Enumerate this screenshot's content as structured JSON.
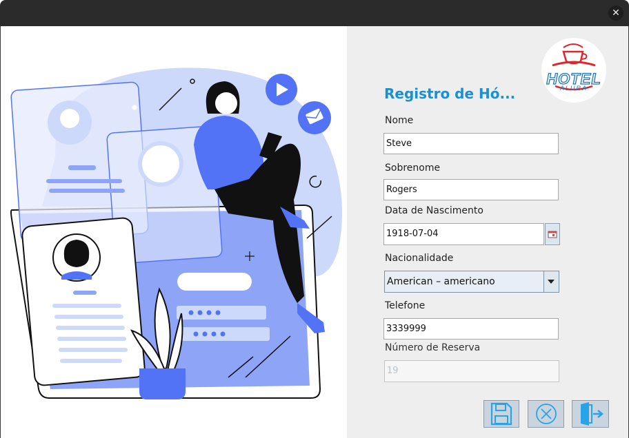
{
  "window": {
    "close_icon": "close-icon"
  },
  "brand": {
    "logo_line1": "HOTEL",
    "logo_line2": "ALURA",
    "logo_color": "#e0242a"
  },
  "form": {
    "title": "Registro de Hó...",
    "title_color": "#1b8fd0",
    "fields": {
      "nome": {
        "label": "Nome",
        "value": "Steve"
      },
      "sobrenome": {
        "label": "Sobrenome",
        "value": "Rogers"
      },
      "data_nascimento": {
        "label": "Data de Nascimento",
        "value": "1918-07-04"
      },
      "nacionalidade": {
        "label": "Nacionalidade",
        "value": "American – americano"
      },
      "telefone": {
        "label": "Telefone",
        "value": "3339999"
      },
      "numero_reserva": {
        "label": "Número de Reserva",
        "value": "19"
      }
    }
  },
  "actions": {
    "save_icon": "save-icon",
    "cancel_icon": "cancel-icon",
    "exit_icon": "exit-icon",
    "icon_color": "#29a3e8"
  },
  "illustration": {
    "accent": "#5273f5",
    "light": "#cdd9fb"
  }
}
